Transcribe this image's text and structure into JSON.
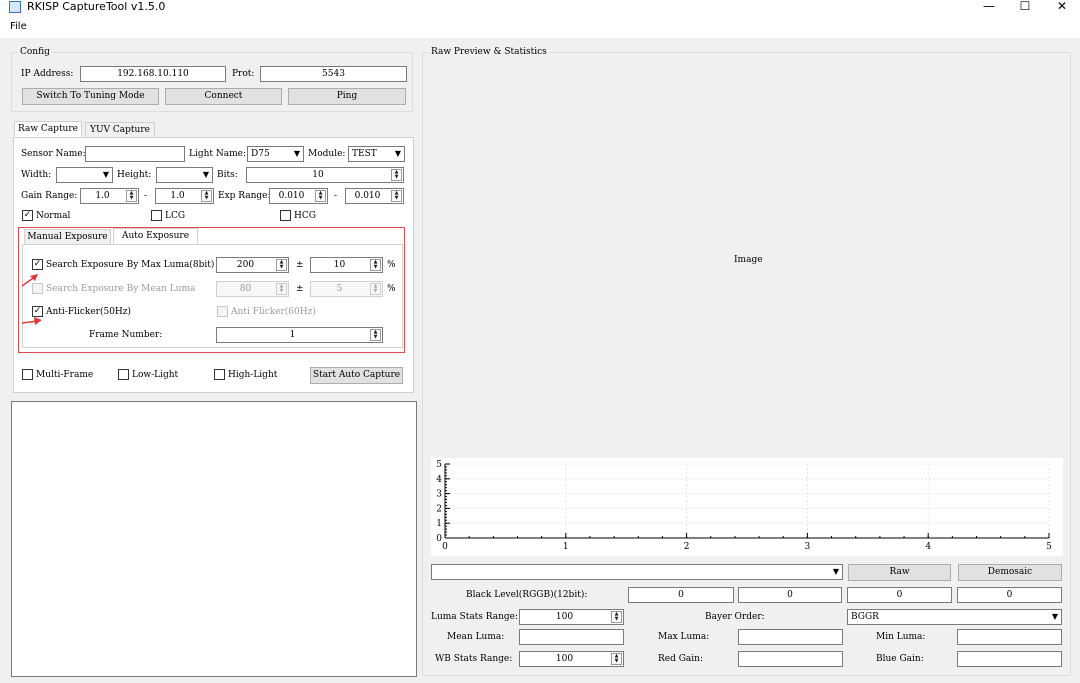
{
  "window": {
    "title": "RKISP CaptureTool v1.5.0",
    "minimize": "—",
    "maximize": "☐",
    "close": "✕"
  },
  "menu": {
    "file": "File"
  },
  "config": {
    "title": "Config",
    "ip_label": "IP Address:",
    "ip_value": "192.168.10.110",
    "port_label": "Prot:",
    "port_value": "5543",
    "switch_btn": "Switch To Tuning Mode",
    "connect_btn": "Connect",
    "ping_btn": "Ping"
  },
  "tabs": {
    "raw": "Raw Capture",
    "yuv": "YUV Capture"
  },
  "raw": {
    "sensor_label": "Sensor Name:",
    "sensor_value": "",
    "light_label": "Light Name:",
    "light_value": "D75",
    "module_label": "Module:",
    "module_value": "TEST",
    "width_label": "Width:",
    "width_value": "",
    "height_label": "Height:",
    "height_value": "",
    "bits_label": "Bits:",
    "bits_value": "10",
    "gain_label": "Gain Range:",
    "gain_min": "1.0",
    "gain_max": "1.0",
    "dash": "-",
    "exp_label": "Exp Range:",
    "exp_min": "0.010",
    "exp_max": "0.010",
    "normal": "Normal",
    "lcg": "LCG",
    "hcg": "HCG"
  },
  "subtabs": {
    "manual": "Manual Exposure",
    "auto": "Auto Exposure"
  },
  "auto": {
    "max_luma_label": "Search Exposure By Max Luma(8bit)",
    "max_luma_value": "200",
    "max_luma_tol": "10",
    "mean_luma_label": "Search Exposure By Mean Luma",
    "mean_luma_value": "80",
    "mean_luma_tol": "5",
    "pm": "±",
    "pct": "%",
    "flicker50": "Anti-Flicker(50Hz)",
    "flicker60": "Anti Flicker(60Hz)",
    "frame_label": "Frame Number:",
    "frame_value": "1"
  },
  "bottom_opts": {
    "multi": "Multi-Frame",
    "low": "Low-Light",
    "high": "High-Light",
    "start_btn": "Start Auto Capture"
  },
  "preview": {
    "title": "Raw Preview & Statistics",
    "image": "Image"
  },
  "chart_data": {
    "type": "line",
    "x_ticks": [
      "0",
      "1",
      "2",
      "3",
      "4",
      "5"
    ],
    "y_ticks": [
      "0",
      "1",
      "2",
      "3",
      "4",
      "5"
    ],
    "xlim": [
      0,
      5
    ],
    "ylim": [
      0,
      5
    ],
    "series": [],
    "grid": true
  },
  "stats": {
    "raw_btn": "Raw",
    "demosaic_btn": "Demosaic",
    "black_label": "Black Level(RGGB)(12bit):",
    "black_values": [
      "0",
      "0",
      "0",
      "0"
    ],
    "luma_range_label": "Luma Stats Range:",
    "luma_range_value": "100",
    "bayer_label": "Bayer Order:",
    "bayer_value": "BGGR",
    "mean_luma_label": "Mean Luma:",
    "max_luma_label": "Max Luma:",
    "min_luma_label": "Min Luma:",
    "wb_range_label": "WB Stats Range:",
    "wb_range_value": "100",
    "red_gain_label": "Red Gain:",
    "blue_gain_label": "Blue Gain:"
  }
}
